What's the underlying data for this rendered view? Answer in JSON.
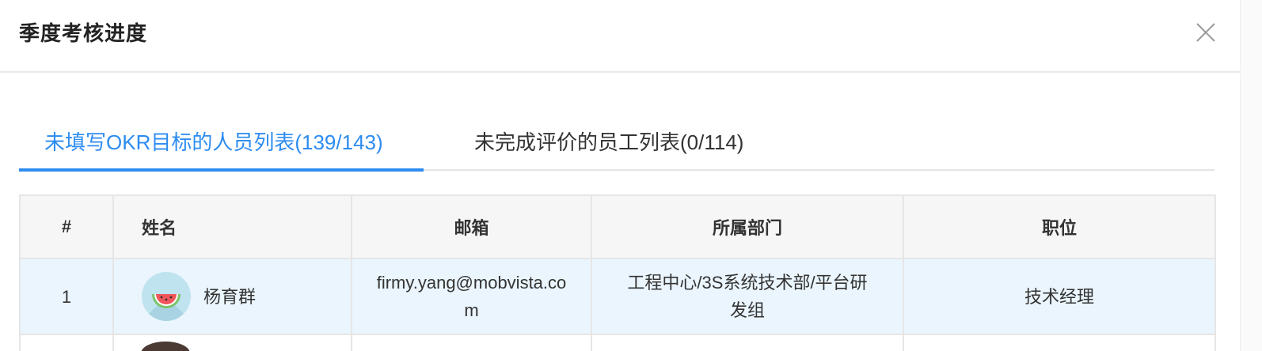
{
  "modal": {
    "title": "季度考核进度",
    "close_icon": "close-icon"
  },
  "tabs": [
    {
      "label": "未填写OKR目标的人员列表(139/143)",
      "active": true
    },
    {
      "label": "未完成评价的员工列表(0/114)",
      "active": false
    }
  ],
  "table": {
    "headers": [
      "#",
      "姓名",
      "邮箱",
      "所属部门",
      "职位"
    ],
    "rows": [
      {
        "index": "1",
        "avatar_icon": "watermelon-avatar-icon",
        "name": "杨育群",
        "email": "firmy.yang@mobvista.com",
        "department": "工程中心/3S系统技术部/平台研发组",
        "position": "技术经理"
      }
    ]
  },
  "colors": {
    "accent": "#2d8cf0",
    "row_highlight": "#eaf5fd",
    "header_bg": "#f6f6f6"
  }
}
